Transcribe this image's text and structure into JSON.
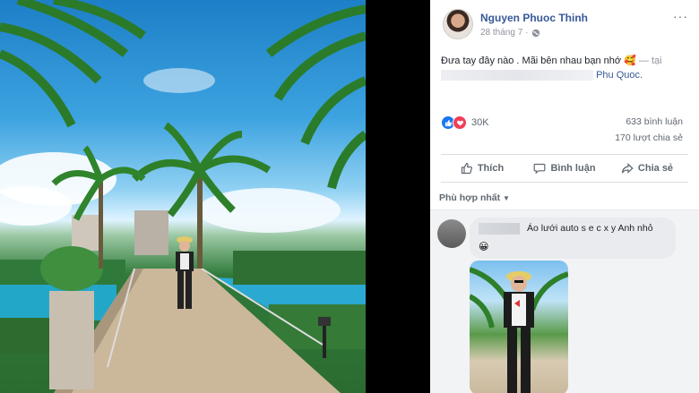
{
  "post": {
    "author": "Nguyen Phuoc Thinh",
    "date": "28 tháng 7",
    "dot": "·",
    "more_label": "···",
    "text": "Đưa tay đây nào . Mãi bên nhau bạn nhớ",
    "emoji": "🥰",
    "tagged_sep": " — tại",
    "place": "Phu Quoc."
  },
  "stats": {
    "reaction_count": "30K",
    "comments": "633 bình luận",
    "shares": "170 lượt chia sẻ"
  },
  "actions": {
    "like": "Thích",
    "comment": "Bình luận",
    "share": "Chia sẻ"
  },
  "sort": {
    "label": "Phù hợp nhất",
    "caret": "▼"
  },
  "comment": {
    "text": "Áo lưới auto s e c x y Anh nhỏ",
    "emoji": "😀"
  },
  "icons": {
    "like": "like-icon",
    "love": "love-icon",
    "comment": "comment-icon",
    "share": "share-icon",
    "globe": "globe-icon"
  },
  "colors": {
    "link": "#385898",
    "like_blue": "#1877f2",
    "love_red": "#f33e58"
  }
}
